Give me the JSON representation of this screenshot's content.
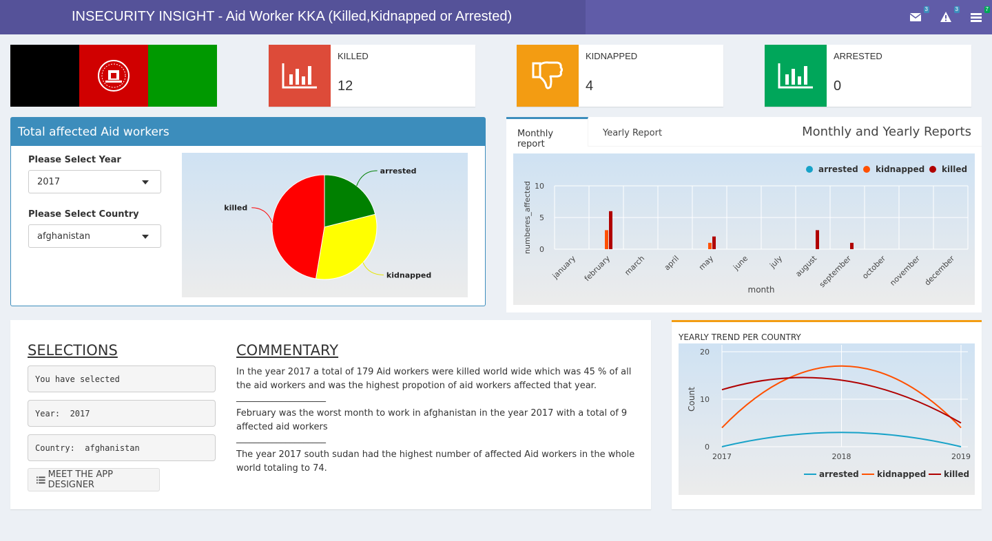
{
  "header": {
    "title": "INSECURITY INSIGHT - Aid Worker KKA (Killed,Kidnapped or Arrested)",
    "messages_badge": "3",
    "notifications_badge": "3",
    "tasks_badge": "7"
  },
  "info_boxes": [
    {
      "label": "KILLED",
      "value": "12",
      "color": "#dd4b39",
      "icon": "bar-chart-icon"
    },
    {
      "label": "KIDNAPPED",
      "value": "4",
      "color": "#f39c12",
      "icon": "thumbs-down-icon"
    },
    {
      "label": "ARRESTED",
      "value": "0",
      "color": "#00a65a",
      "icon": "bar-chart-icon"
    }
  ],
  "affected_box": {
    "title": "Total affected Aid workers",
    "year_label": "Please Select Year",
    "year_value": "2017",
    "country_label": "Please Select Country",
    "country_value": "afghanistan"
  },
  "reports": {
    "tabs": [
      "Monthly report",
      "Yearly Report"
    ],
    "active_tab": "Monthly report",
    "title": "Monthly and Yearly Reports"
  },
  "selections": {
    "heading": "SELECTIONS",
    "line1": "You have selected",
    "line2": "Year:  2017",
    "line3": "Country:  afghanistan",
    "button": "MEET THE APP DESIGNER"
  },
  "commentary": {
    "heading": "COMMENTARY",
    "p1": "In the year 2017 a total of 179 Aid workers were killed world wide which was 45 % of all the aid workers and was the highest propotion of aid workers affected that year.",
    "sep1": "____________________",
    "p2": "February was the worst month to work in afghanistan in the year 2017 with a total of 9 affected aid workers",
    "sep2": "____________________",
    "p3": "The year 2017 south sudan had the highest number of affected Aid workers in the whole world totaling to 74."
  },
  "trend": {
    "title": "YEARLY TREND PER COUNTRY"
  },
  "chart_data": [
    {
      "type": "pie",
      "labels": [
        "arrested",
        "kidnapped",
        "killed"
      ],
      "values": [
        2,
        3,
        4.5
      ],
      "colors": [
        "#008000",
        "#ffff00",
        "#ff0000"
      ]
    },
    {
      "type": "bar",
      "xlabel": "month",
      "ylabel": "numberes_affected",
      "categories": [
        "january",
        "february",
        "march",
        "april",
        "may",
        "june",
        "july",
        "august",
        "september",
        "october",
        "november",
        "december"
      ],
      "ylim": [
        0,
        10
      ],
      "yticks": [
        0,
        5,
        10
      ],
      "legend_position": "top-right",
      "series": [
        {
          "name": "arrested",
          "color": "#17a2c8",
          "values": [
            0,
            0,
            0,
            0,
            0,
            0,
            0,
            0,
            0,
            0,
            0,
            0
          ]
        },
        {
          "name": "kidnapped",
          "color": "#ff5000",
          "values": [
            0,
            3,
            0,
            0,
            1,
            0,
            0,
            0,
            0,
            0,
            0,
            0
          ]
        },
        {
          "name": "killed",
          "color": "#b00000",
          "values": [
            0,
            6,
            0,
            0,
            2,
            0,
            0,
            3,
            1,
            0,
            0,
            0
          ]
        }
      ]
    },
    {
      "type": "line",
      "xlabel": "",
      "ylabel": "Count",
      "x": [
        2017,
        2018,
        2019
      ],
      "ylim": [
        0,
        20
      ],
      "yticks": [
        0,
        10,
        20
      ],
      "legend_position": "bottom-right",
      "series": [
        {
          "name": "arrested",
          "color": "#17a2c8",
          "values": [
            0,
            3,
            0
          ]
        },
        {
          "name": "kidnapped",
          "color": "#ff5000",
          "values": [
            4,
            17,
            4
          ]
        },
        {
          "name": "killed",
          "color": "#b00000",
          "values": [
            12,
            14,
            5
          ]
        }
      ]
    }
  ]
}
